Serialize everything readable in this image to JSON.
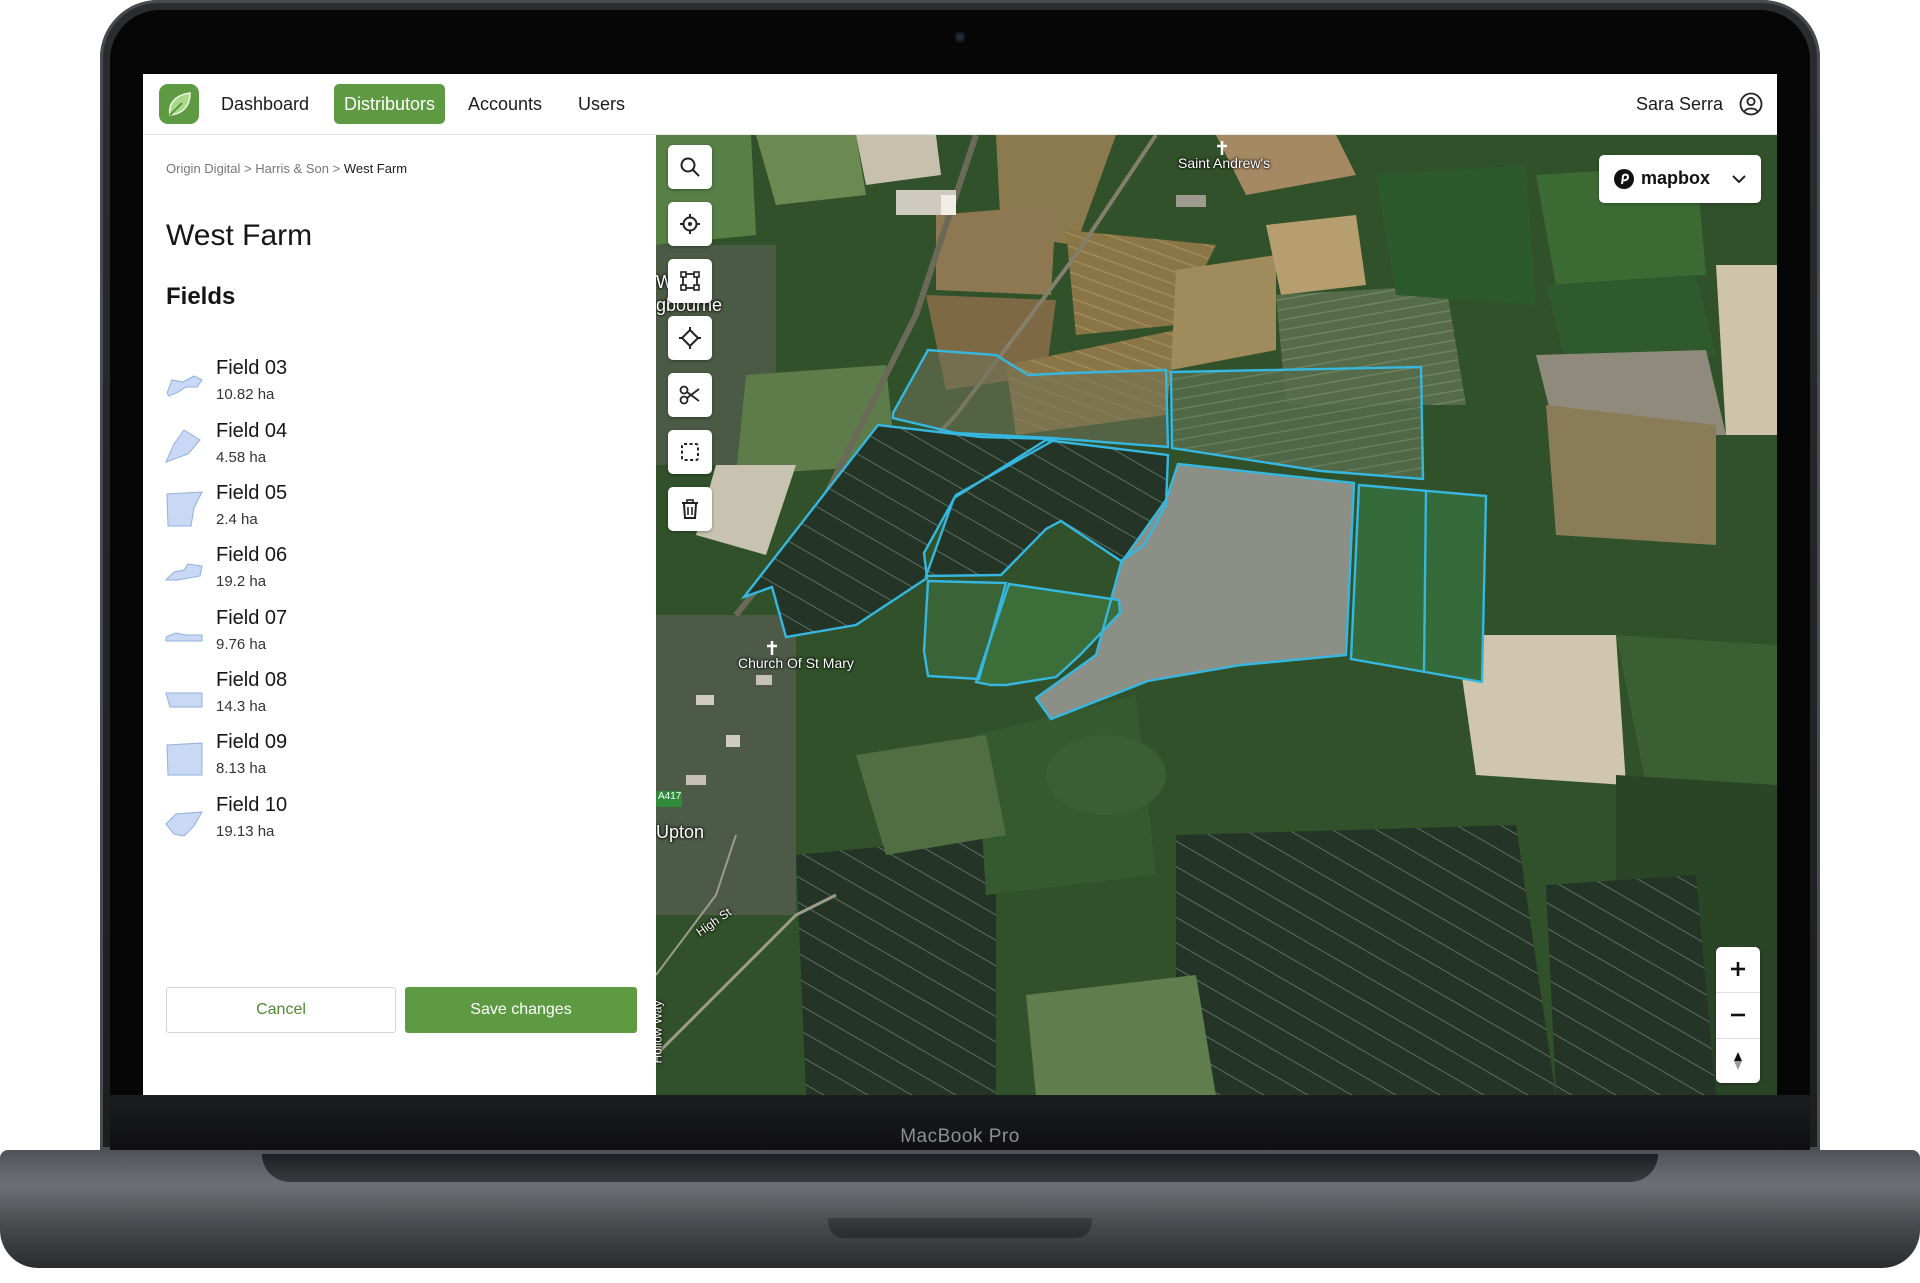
{
  "device": {
    "brand": "MacBook Pro"
  },
  "nav": {
    "items": [
      {
        "label": "Dashboard",
        "active": false
      },
      {
        "label": "Distributors",
        "active": true
      },
      {
        "label": "Accounts",
        "active": false
      },
      {
        "label": "Users",
        "active": false
      }
    ],
    "user_name": "Sara Serra"
  },
  "breadcrumb": {
    "items": [
      "Origin Digital",
      "Harris & Son"
    ],
    "current": "West Farm",
    "separator": ">"
  },
  "farm": {
    "name": "West Farm",
    "section_title": "Fields"
  },
  "fields": [
    {
      "name": "Field 03",
      "area": "10.82 ha"
    },
    {
      "name": "Field 04",
      "area": "4.58 ha"
    },
    {
      "name": "Field 05",
      "area": "2.4 ha"
    },
    {
      "name": "Field 06",
      "area": "19.2 ha"
    },
    {
      "name": "Field 07",
      "area": "9.76 ha"
    },
    {
      "name": "Field 08",
      "area": "14.3 ha"
    },
    {
      "name": "Field 09",
      "area": "8.13 ha"
    },
    {
      "name": "Field 10",
      "area": "19.13 ha"
    }
  ],
  "actions": {
    "cancel": "Cancel",
    "save": "Save changes"
  },
  "map": {
    "style_selector": "mapbox",
    "labels": {
      "church_north": "Saint Andrew's",
      "church_south": "Church Of St Mary",
      "village_top": "W",
      "village_top_2": "gbourne",
      "village": "Upton",
      "road_high": "High St",
      "road_hollow": "Hollow Way",
      "road_shield": "A417"
    },
    "tools": [
      "search-icon",
      "locate-icon",
      "polygon-icon",
      "vertex-icon",
      "scissors-icon",
      "select-icon",
      "trash-icon"
    ],
    "zoom_controls": [
      "plus-icon",
      "minus-icon",
      "compass-icon"
    ]
  },
  "colors": {
    "brand_green": "#5e9a41",
    "field_outline": "#35b7e0",
    "field_thumbnail": "#c9d9f5"
  }
}
